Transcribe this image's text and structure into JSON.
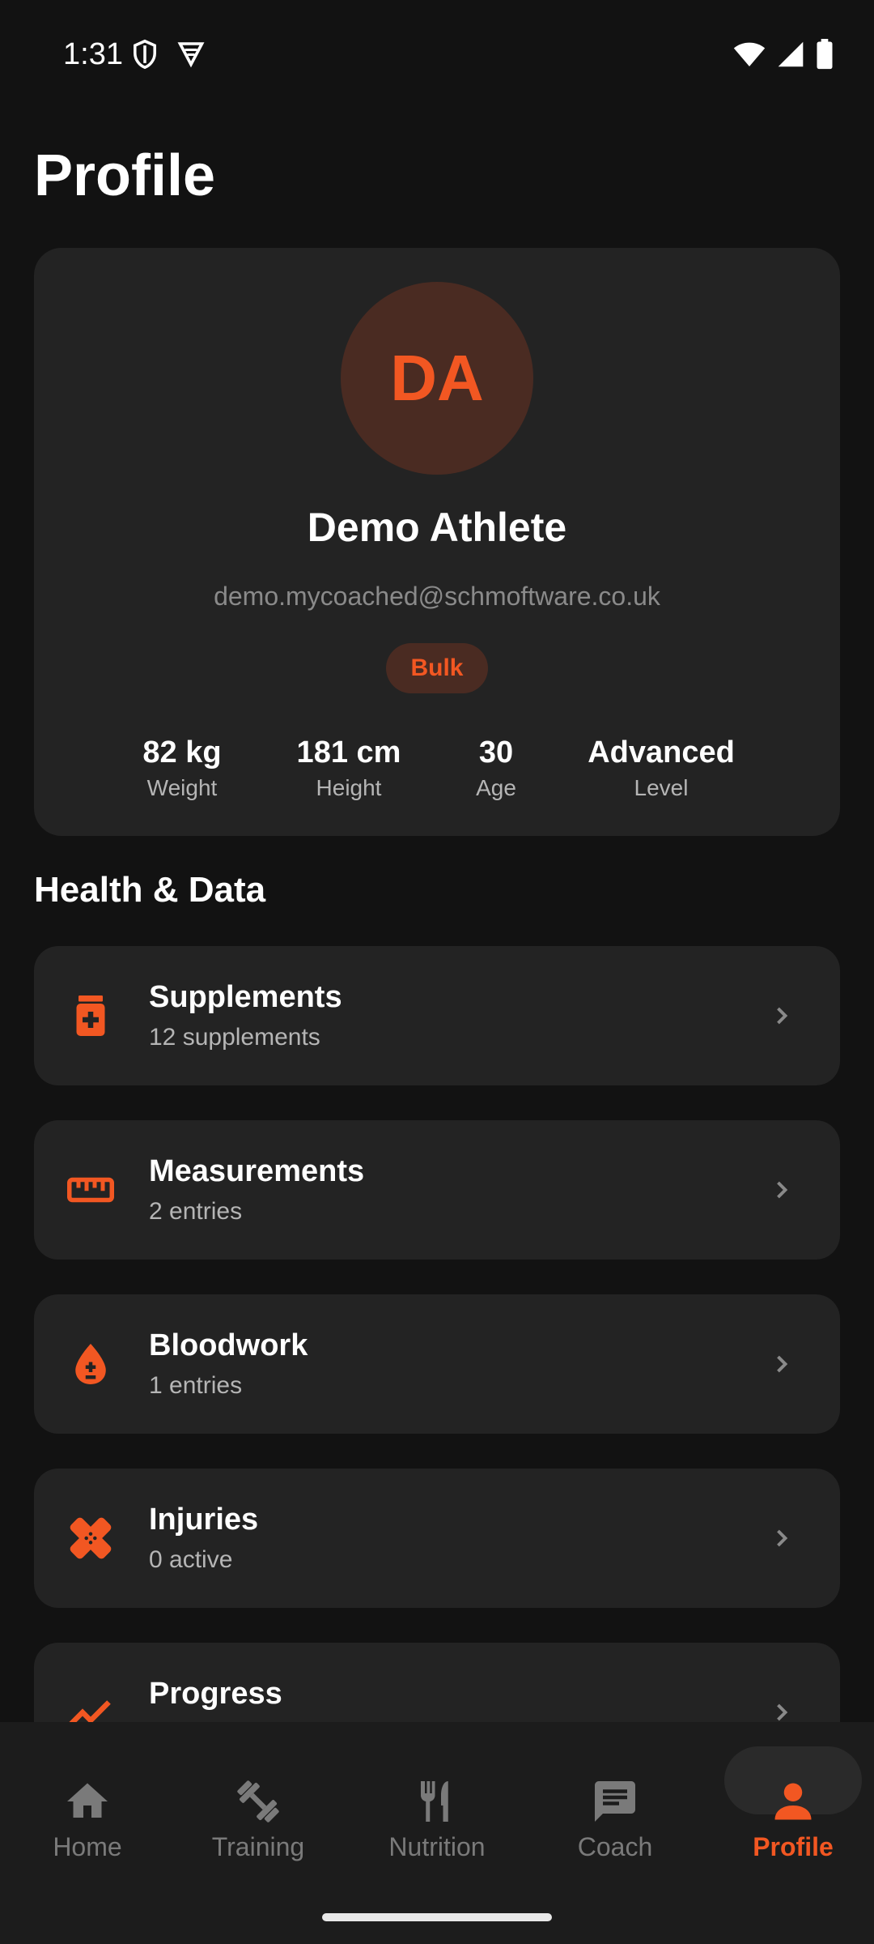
{
  "status_bar": {
    "time": "1:31"
  },
  "page": {
    "title": "Profile"
  },
  "profile": {
    "initials": "DA",
    "name": "Demo Athlete",
    "email": "demo.mycoached@schmoftware.co.uk",
    "goal": "Bulk",
    "stats": [
      {
        "value": "82 kg",
        "label": "Weight"
      },
      {
        "value": "181 cm",
        "label": "Height"
      },
      {
        "value": "30",
        "label": "Age"
      },
      {
        "value": "Advanced",
        "label": "Level"
      }
    ]
  },
  "health_section": {
    "title": "Health & Data",
    "items": [
      {
        "title": "Supplements",
        "subtitle": "12 supplements",
        "icon": "supplement-bottle-icon"
      },
      {
        "title": "Measurements",
        "subtitle": "2 entries",
        "icon": "ruler-icon"
      },
      {
        "title": "Bloodwork",
        "subtitle": "1 entries",
        "icon": "blood-drop-icon"
      },
      {
        "title": "Injuries",
        "subtitle": "0 active",
        "icon": "bandage-icon"
      },
      {
        "title": "Progress",
        "subtitle": "",
        "icon": "trending-up-icon"
      }
    ]
  },
  "bottom_nav": {
    "items": [
      {
        "label": "Home",
        "icon": "home-icon"
      },
      {
        "label": "Training",
        "icon": "dumbbell-icon"
      },
      {
        "label": "Nutrition",
        "icon": "fork-knife-icon"
      },
      {
        "label": "Coach",
        "icon": "chat-icon"
      },
      {
        "label": "Profile",
        "icon": "person-icon",
        "active": true
      }
    ]
  },
  "colors": {
    "accent": "#f25722",
    "background": "#121212",
    "card": "#232323",
    "muted_text": "#b5b5b5"
  }
}
